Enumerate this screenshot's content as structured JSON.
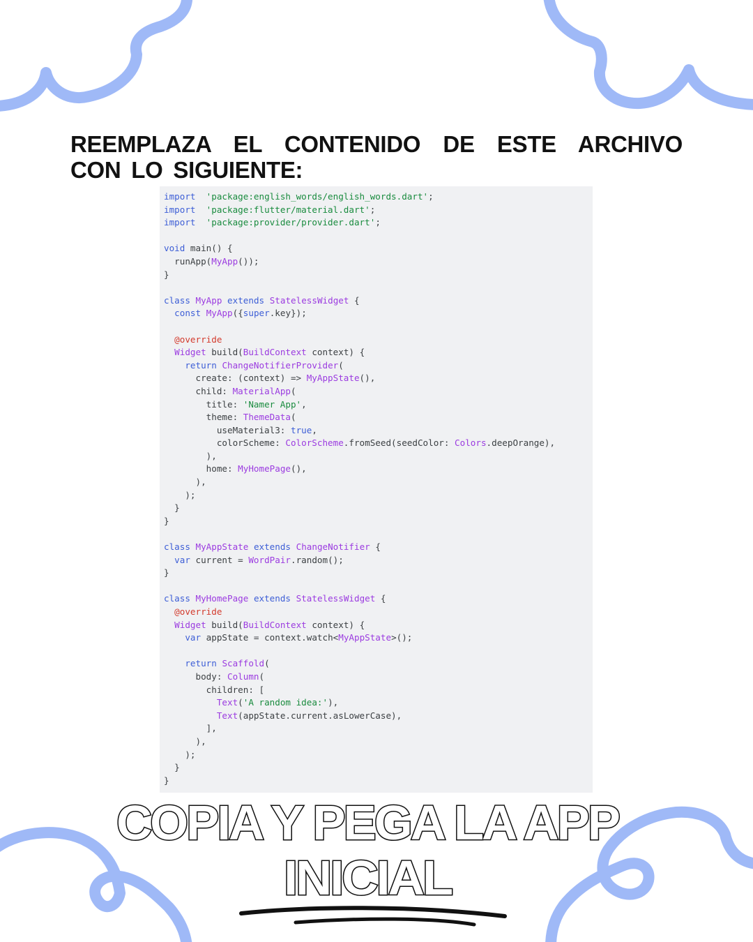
{
  "heading": "REEMPLAZA EL CONTENIDO DE ESTE ARCHIVO CON LO SIGUIENTE:",
  "title": {
    "line1": "COPIA Y PEGA LA APP",
    "line2": "INICIAL"
  },
  "code": [
    [
      [
        "k",
        "import"
      ],
      [
        "",
        "  "
      ],
      [
        "s",
        "'package:english_words/english_words.dart'"
      ],
      [
        "",
        ";"
      ]
    ],
    [
      [
        "k",
        "import"
      ],
      [
        "",
        "  "
      ],
      [
        "s",
        "'package:flutter/material.dart'"
      ],
      [
        "",
        ";"
      ]
    ],
    [
      [
        "k",
        "import"
      ],
      [
        "",
        "  "
      ],
      [
        "s",
        "'package:provider/provider.dart'"
      ],
      [
        "",
        ";"
      ]
    ],
    [],
    [
      [
        "k",
        "void"
      ],
      [
        "",
        " main() {"
      ]
    ],
    [
      [
        "",
        "  runApp("
      ],
      [
        "t",
        "MyApp"
      ],
      [
        "",
        "());"
      ]
    ],
    [
      [
        "",
        "}"
      ]
    ],
    [],
    [
      [
        "k",
        "class"
      ],
      [
        "",
        " "
      ],
      [
        "t",
        "MyApp"
      ],
      [
        "",
        " "
      ],
      [
        "k",
        "extends"
      ],
      [
        "",
        " "
      ],
      [
        "t",
        "StatelessWidget"
      ],
      [
        "",
        " {"
      ]
    ],
    [
      [
        "",
        "  "
      ],
      [
        "k",
        "const"
      ],
      [
        "",
        " "
      ],
      [
        "t",
        "MyApp"
      ],
      [
        "",
        "({"
      ],
      [
        "k",
        "super"
      ],
      [
        "",
        ".key});"
      ]
    ],
    [],
    [
      [
        "",
        "  "
      ],
      [
        "a",
        "@override"
      ]
    ],
    [
      [
        "",
        "  "
      ],
      [
        "t",
        "Widget"
      ],
      [
        "",
        " build("
      ],
      [
        "t",
        "BuildContext"
      ],
      [
        "",
        " context) {"
      ]
    ],
    [
      [
        "",
        "    "
      ],
      [
        "k",
        "return"
      ],
      [
        "",
        " "
      ],
      [
        "t",
        "ChangeNotifierProvider"
      ],
      [
        "",
        "("
      ]
    ],
    [
      [
        "",
        "      create: (context) => "
      ],
      [
        "t",
        "MyAppState"
      ],
      [
        "",
        "(),"
      ]
    ],
    [
      [
        "",
        "      child: "
      ],
      [
        "t",
        "MaterialApp"
      ],
      [
        "",
        "("
      ]
    ],
    [
      [
        "",
        "        title: "
      ],
      [
        "s",
        "'Namer App'"
      ],
      [
        "",
        ","
      ]
    ],
    [
      [
        "",
        "        theme: "
      ],
      [
        "t",
        "ThemeData"
      ],
      [
        "",
        "("
      ]
    ],
    [
      [
        "",
        "          useMaterial3: "
      ],
      [
        "k",
        "true"
      ],
      [
        "",
        ","
      ]
    ],
    [
      [
        "",
        "          colorScheme: "
      ],
      [
        "t",
        "ColorScheme"
      ],
      [
        "",
        ".fromSeed(seedColor: "
      ],
      [
        "t",
        "Colors"
      ],
      [
        "",
        ".deepOrange),"
      ]
    ],
    [
      [
        "",
        "        ),"
      ]
    ],
    [
      [
        "",
        "        home: "
      ],
      [
        "t",
        "MyHomePage"
      ],
      [
        "",
        "(),"
      ]
    ],
    [
      [
        "",
        "      ),"
      ]
    ],
    [
      [
        "",
        "    );"
      ]
    ],
    [
      [
        "",
        "  }"
      ]
    ],
    [
      [
        "",
        "}"
      ]
    ],
    [],
    [
      [
        "k",
        "class"
      ],
      [
        "",
        " "
      ],
      [
        "t",
        "MyAppState"
      ],
      [
        "",
        " "
      ],
      [
        "k",
        "extends"
      ],
      [
        "",
        " "
      ],
      [
        "t",
        "ChangeNotifier"
      ],
      [
        "",
        " {"
      ]
    ],
    [
      [
        "",
        "  "
      ],
      [
        "k",
        "var"
      ],
      [
        "",
        " current = "
      ],
      [
        "t",
        "WordPair"
      ],
      [
        "",
        ".random();"
      ]
    ],
    [
      [
        "",
        "}"
      ]
    ],
    [],
    [
      [
        "k",
        "class"
      ],
      [
        "",
        " "
      ],
      [
        "t",
        "MyHomePage"
      ],
      [
        "",
        " "
      ],
      [
        "k",
        "extends"
      ],
      [
        "",
        " "
      ],
      [
        "t",
        "StatelessWidget"
      ],
      [
        "",
        " {"
      ]
    ],
    [
      [
        "",
        "  "
      ],
      [
        "a",
        "@override"
      ]
    ],
    [
      [
        "",
        "  "
      ],
      [
        "t",
        "Widget"
      ],
      [
        "",
        " build("
      ],
      [
        "t",
        "BuildContext"
      ],
      [
        "",
        " context) {"
      ]
    ],
    [
      [
        "",
        "    "
      ],
      [
        "k",
        "var"
      ],
      [
        "",
        " appState = context.watch<"
      ],
      [
        "t",
        "MyAppState"
      ],
      [
        "",
        ">();"
      ]
    ],
    [],
    [
      [
        "",
        "    "
      ],
      [
        "k",
        "return"
      ],
      [
        "",
        " "
      ],
      [
        "t",
        "Scaffold"
      ],
      [
        "",
        "("
      ]
    ],
    [
      [
        "",
        "      body: "
      ],
      [
        "t",
        "Column"
      ],
      [
        "",
        "("
      ]
    ],
    [
      [
        "",
        "        children: ["
      ]
    ],
    [
      [
        "",
        "          "
      ],
      [
        "t",
        "Text"
      ],
      [
        "",
        "("
      ],
      [
        "s",
        "'A random idea:'"
      ],
      [
        "",
        "),"
      ]
    ],
    [
      [
        "",
        "          "
      ],
      [
        "t",
        "Text"
      ],
      [
        "",
        "(appState.current.asLowerCase),"
      ]
    ],
    [
      [
        "",
        "        ],"
      ]
    ],
    [
      [
        "",
        "      ),"
      ]
    ],
    [
      [
        "",
        "    );"
      ]
    ],
    [
      [
        "",
        "  }"
      ]
    ],
    [
      [
        "",
        "}"
      ]
    ]
  ],
  "colors": {
    "decor": "#9fb9f7",
    "keyword": "#3d5ed6",
    "string": "#198b3e",
    "type": "#9b3be0",
    "annotation": "#d33a2c",
    "code_background": "#f0f1f3"
  }
}
